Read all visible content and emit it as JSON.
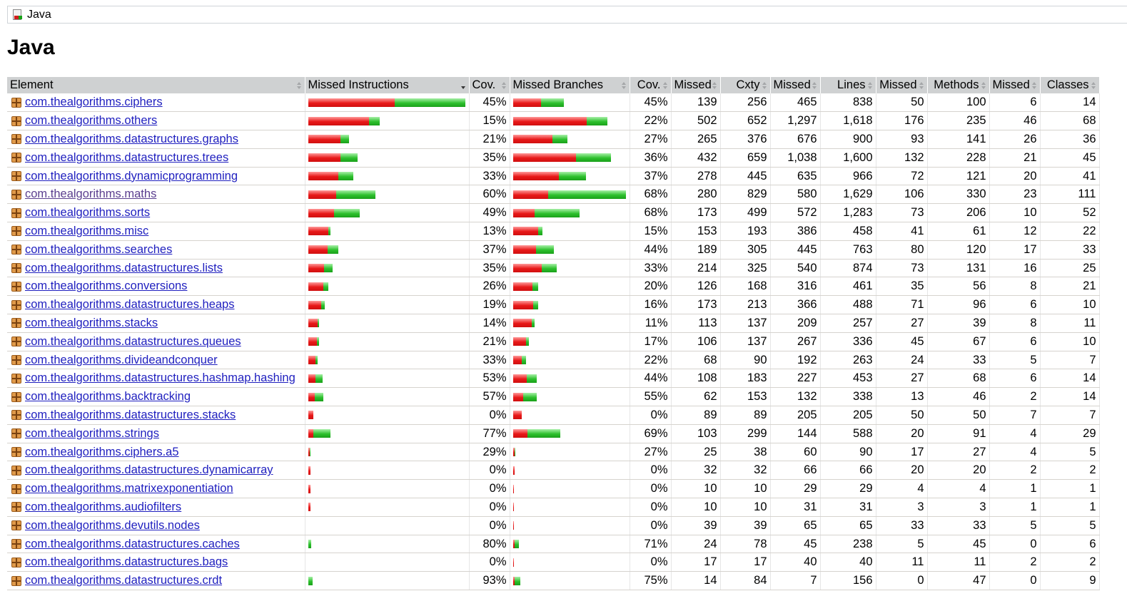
{
  "breadcrumb": {
    "label": "Java"
  },
  "page_title": "Java",
  "colors": {
    "missed_bar": "#e81818",
    "covered_bar": "#2dc02d",
    "header_bg": "#cfd1d2",
    "link": "#1f1fbf"
  },
  "table": {
    "headers": {
      "element": "Element",
      "missed_instructions": "Missed Instructions",
      "cov_instructions": "Cov.",
      "missed_branches": "Missed Branches",
      "cov_branches": "Cov.",
      "missed_cxty": "Missed",
      "cxty": "Cxty",
      "missed_lines": "Missed",
      "lines": "Lines",
      "missed_methods": "Missed",
      "methods": "Methods",
      "missed_classes": "Missed",
      "classes": "Classes"
    },
    "sorted_column": "missed_instructions",
    "rows": [
      {
        "name": "com.thealgorithms.ciphers",
        "ins_cov": "45%",
        "br_cov": "45%",
        "mc": "139",
        "c": "256",
        "ml": "465",
        "l": "838",
        "mm": "50",
        "m": "100",
        "mcl": "6",
        "cl": "14",
        "ins_bar": {
          "missed": 0.55,
          "covered": 0.45
        },
        "br_bar": {
          "missed": 0.245,
          "covered": 0.2
        }
      },
      {
        "name": "com.thealgorithms.others",
        "ins_cov": "15%",
        "br_cov": "22%",
        "mc": "502",
        "c": "652",
        "ml": "1,297",
        "l": "1,618",
        "mm": "176",
        "m": "235",
        "mcl": "46",
        "cl": "68",
        "ins_bar": {
          "missed": 0.385,
          "covered": 0.068
        },
        "br_bar": {
          "missed": 0.655,
          "covered": 0.185
        }
      },
      {
        "name": "com.thealgorithms.datastructures.graphs",
        "ins_cov": "21%",
        "br_cov": "27%",
        "mc": "265",
        "c": "376",
        "ml": "676",
        "l": "900",
        "mm": "93",
        "m": "141",
        "mcl": "26",
        "cl": "36",
        "ins_bar": {
          "missed": 0.203,
          "covered": 0.054
        },
        "br_bar": {
          "missed": 0.345,
          "covered": 0.13
        }
      },
      {
        "name": "com.thealgorithms.datastructures.trees",
        "ins_cov": "35%",
        "br_cov": "36%",
        "mc": "432",
        "c": "659",
        "ml": "1,038",
        "l": "1,600",
        "mm": "132",
        "m": "228",
        "mcl": "21",
        "cl": "45",
        "ins_bar": {
          "missed": 0.203,
          "covered": 0.108
        },
        "br_bar": {
          "missed": 0.555,
          "covered": 0.31
        }
      },
      {
        "name": "com.thealgorithms.dynamicprogramming",
        "ins_cov": "33%",
        "br_cov": "37%",
        "mc": "278",
        "c": "445",
        "ml": "635",
        "l": "966",
        "mm": "72",
        "m": "121",
        "mcl": "20",
        "cl": "41",
        "ins_bar": {
          "missed": 0.189,
          "covered": 0.095
        },
        "br_bar": {
          "missed": 0.405,
          "covered": 0.24
        }
      },
      {
        "name": "com.thealgorithms.maths",
        "ins_cov": "60%",
        "br_cov": "68%",
        "mc": "280",
        "c": "829",
        "ml": "580",
        "l": "1,629",
        "mm": "106",
        "m": "330",
        "mcl": "23",
        "cl": "111",
        "visited": true,
        "ins_bar": {
          "missed": 0.176,
          "covered": 0.25
        },
        "br_bar": {
          "missed": 0.31,
          "covered": 0.69
        }
      },
      {
        "name": "com.thealgorithms.sorts",
        "ins_cov": "49%",
        "br_cov": "68%",
        "mc": "173",
        "c": "499",
        "ml": "572",
        "l": "1,283",
        "mm": "73",
        "m": "206",
        "mcl": "10",
        "cl": "52",
        "ins_bar": {
          "missed": 0.162,
          "covered": 0.162
        },
        "br_bar": {
          "missed": 0.19,
          "covered": 0.4
        }
      },
      {
        "name": "com.thealgorithms.misc",
        "ins_cov": "13%",
        "br_cov": "15%",
        "mc": "153",
        "c": "193",
        "ml": "386",
        "l": "458",
        "mm": "41",
        "m": "61",
        "mcl": "12",
        "cl": "22",
        "ins_bar": {
          "missed": 0.128,
          "covered": 0.013
        },
        "br_bar": {
          "missed": 0.22,
          "covered": 0.035
        }
      },
      {
        "name": "com.thealgorithms.searches",
        "ins_cov": "37%",
        "br_cov": "44%",
        "mc": "189",
        "c": "305",
        "ml": "445",
        "l": "763",
        "mm": "80",
        "m": "120",
        "mcl": "17",
        "cl": "33",
        "ins_bar": {
          "missed": 0.122,
          "covered": 0.068
        },
        "br_bar": {
          "missed": 0.2,
          "covered": 0.16
        }
      },
      {
        "name": "com.thealgorithms.datastructures.lists",
        "ins_cov": "35%",
        "br_cov": "33%",
        "mc": "214",
        "c": "325",
        "ml": "540",
        "l": "874",
        "mm": "73",
        "m": "131",
        "mcl": "16",
        "cl": "25",
        "ins_bar": {
          "missed": 0.101,
          "covered": 0.054
        },
        "br_bar": {
          "missed": 0.25,
          "covered": 0.135
        }
      },
      {
        "name": "com.thealgorithms.conversions",
        "ins_cov": "26%",
        "br_cov": "20%",
        "mc": "126",
        "c": "168",
        "ml": "316",
        "l": "461",
        "mm": "35",
        "m": "56",
        "mcl": "8",
        "cl": "21",
        "ins_bar": {
          "missed": 0.095,
          "covered": 0.034
        },
        "br_bar": {
          "missed": 0.17,
          "covered": 0.05
        }
      },
      {
        "name": "com.thealgorithms.datastructures.heaps",
        "ins_cov": "19%",
        "br_cov": "16%",
        "mc": "173",
        "c": "213",
        "ml": "366",
        "l": "488",
        "mm": "71",
        "m": "96",
        "mcl": "6",
        "cl": "10",
        "ins_bar": {
          "missed": 0.081,
          "covered": 0.021
        },
        "br_bar": {
          "missed": 0.18,
          "covered": 0.045
        }
      },
      {
        "name": "com.thealgorithms.stacks",
        "ins_cov": "14%",
        "br_cov": "11%",
        "mc": "113",
        "c": "137",
        "ml": "209",
        "l": "257",
        "mm": "27",
        "m": "39",
        "mcl": "8",
        "cl": "11",
        "ins_bar": {
          "missed": 0.061,
          "covered": 0.008
        },
        "br_bar": {
          "missed": 0.165,
          "covered": 0.025
        }
      },
      {
        "name": "com.thealgorithms.datastructures.queues",
        "ins_cov": "21%",
        "br_cov": "17%",
        "mc": "106",
        "c": "137",
        "ml": "267",
        "l": "336",
        "mm": "45",
        "m": "67",
        "mcl": "6",
        "cl": "10",
        "ins_bar": {
          "missed": 0.054,
          "covered": 0.014
        },
        "br_bar": {
          "missed": 0.115,
          "covered": 0.025
        }
      },
      {
        "name": "com.thealgorithms.divideandconquer",
        "ins_cov": "33%",
        "br_cov": "22%",
        "mc": "68",
        "c": "90",
        "ml": "192",
        "l": "263",
        "mm": "24",
        "m": "33",
        "mcl": "5",
        "cl": "7",
        "ins_bar": {
          "missed": 0.047,
          "covered": 0.014
        },
        "br_bar": {
          "missed": 0.075,
          "covered": 0.035
        }
      },
      {
        "name": "com.thealgorithms.datastructures.hashmap.hashing",
        "ins_cov": "53%",
        "br_cov": "44%",
        "mc": "108",
        "c": "183",
        "ml": "227",
        "l": "453",
        "mm": "27",
        "m": "68",
        "mcl": "6",
        "cl": "14",
        "ins_bar": {
          "missed": 0.047,
          "covered": 0.047
        },
        "br_bar": {
          "missed": 0.12,
          "covered": 0.09
        }
      },
      {
        "name": "com.thealgorithms.backtracking",
        "ins_cov": "57%",
        "br_cov": "55%",
        "mc": "62",
        "c": "153",
        "ml": "132",
        "l": "338",
        "mm": "13",
        "m": "46",
        "mcl": "2",
        "cl": "14",
        "ins_bar": {
          "missed": 0.041,
          "covered": 0.054
        },
        "br_bar": {
          "missed": 0.09,
          "covered": 0.12
        }
      },
      {
        "name": "com.thealgorithms.datastructures.stacks",
        "ins_cov": "0%",
        "br_cov": "0%",
        "mc": "89",
        "c": "89",
        "ml": "205",
        "l": "205",
        "mm": "50",
        "m": "50",
        "mcl": "7",
        "cl": "7",
        "ins_bar": {
          "missed": 0.034,
          "covered": 0
        },
        "br_bar": {
          "missed": 0.075,
          "covered": 0
        }
      },
      {
        "name": "com.thealgorithms.strings",
        "ins_cov": "77%",
        "br_cov": "69%",
        "mc": "103",
        "c": "299",
        "ml": "144",
        "l": "588",
        "mm": "20",
        "m": "91",
        "mcl": "4",
        "cl": "29",
        "ins_bar": {
          "missed": 0.034,
          "covered": 0.108
        },
        "br_bar": {
          "missed": 0.125,
          "covered": 0.29
        }
      },
      {
        "name": "com.thealgorithms.ciphers.a5",
        "ins_cov": "29%",
        "br_cov": "27%",
        "mc": "25",
        "c": "38",
        "ml": "60",
        "l": "90",
        "mm": "17",
        "m": "27",
        "mcl": "4",
        "cl": "5",
        "ins_bar": {
          "missed": 0.01,
          "covered": 0.004
        },
        "br_bar": {
          "missed": 0.01,
          "covered": 0.004
        }
      },
      {
        "name": "com.thealgorithms.datastructures.dynamicarray",
        "ins_cov": "0%",
        "br_cov": "0%",
        "mc": "32",
        "c": "32",
        "ml": "66",
        "l": "66",
        "mm": "20",
        "m": "20",
        "mcl": "2",
        "cl": "2",
        "ins_bar": {
          "missed": 0.013,
          "covered": 0
        },
        "br_bar": {
          "missed": 0.013,
          "covered": 0
        }
      },
      {
        "name": "com.thealgorithms.matrixexponentiation",
        "ins_cov": "0%",
        "br_cov": "0%",
        "mc": "10",
        "c": "10",
        "ml": "29",
        "l": "29",
        "mm": "4",
        "m": "4",
        "mcl": "1",
        "cl": "1",
        "ins_bar": {
          "missed": 0.013,
          "covered": 0
        },
        "br_bar": {
          "missed": 0.007,
          "covered": 0
        }
      },
      {
        "name": "com.thealgorithms.audiofilters",
        "ins_cov": "0%",
        "br_cov": "0%",
        "mc": "10",
        "c": "10",
        "ml": "31",
        "l": "31",
        "mm": "3",
        "m": "3",
        "mcl": "1",
        "cl": "1",
        "ins_bar": {
          "missed": 0.013,
          "covered": 0
        },
        "br_bar": {
          "missed": 0.007,
          "covered": 0
        }
      },
      {
        "name": "com.thealgorithms.devutils.nodes",
        "ins_cov": "0%",
        "br_cov": "0%",
        "mc": "39",
        "c": "39",
        "ml": "65",
        "l": "65",
        "mm": "33",
        "m": "33",
        "mcl": "5",
        "cl": "5",
        "ins_bar": {
          "missed": 0,
          "covered": 0
        },
        "br_bar": {
          "missed": 0.007,
          "covered": 0
        }
      },
      {
        "name": "com.thealgorithms.datastructures.caches",
        "ins_cov": "80%",
        "br_cov": "71%",
        "mc": "24",
        "c": "78",
        "ml": "45",
        "l": "238",
        "mm": "5",
        "m": "45",
        "mcl": "0",
        "cl": "6",
        "ins_bar": {
          "missed": 0,
          "covered": 0.02
        },
        "br_bar": {
          "missed": 0.01,
          "covered": 0.04
        }
      },
      {
        "name": "com.thealgorithms.datastructures.bags",
        "ins_cov": "0%",
        "br_cov": "0%",
        "mc": "17",
        "c": "17",
        "ml": "40",
        "l": "40",
        "mm": "11",
        "m": "11",
        "mcl": "2",
        "cl": "2",
        "ins_bar": {
          "missed": 0,
          "covered": 0
        },
        "br_bar": {
          "missed": 0.007,
          "covered": 0
        }
      },
      {
        "name": "com.thealgorithms.datastructures.crdt",
        "ins_cov": "93%",
        "br_cov": "75%",
        "mc": "14",
        "c": "84",
        "ml": "7",
        "l": "156",
        "mm": "0",
        "m": "47",
        "mcl": "0",
        "cl": "9",
        "ins_bar": {
          "missed": 0,
          "covered": 0.027
        },
        "br_bar": {
          "missed": 0.013,
          "covered": 0.05
        }
      }
    ]
  }
}
